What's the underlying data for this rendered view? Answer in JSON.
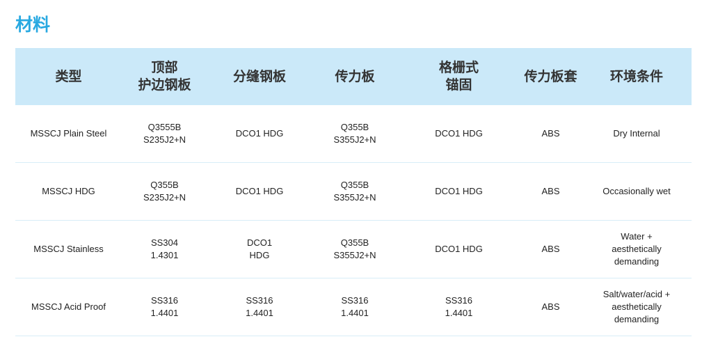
{
  "page": {
    "title": "材料"
  },
  "table": {
    "headers": [
      "类型",
      "顶部\n护边钢板",
      "分缝钢板",
      "传力板",
      "格栅式\n锚固",
      "传力板套",
      "环境条件"
    ],
    "rows": [
      [
        "MSSCJ Plain Steel",
        "Q3555B\nS235J2+N",
        "DCO1 HDG",
        "Q355B\nS355J2+N",
        "DCO1 HDG",
        "ABS",
        "Dry Internal"
      ],
      [
        "MSSCJ HDG",
        "Q355B\nS235J2+N",
        "DCO1 HDG",
        "Q355B\nS355J2+N",
        "DCO1 HDG",
        "ABS",
        "Occasionally wet"
      ],
      [
        "MSSCJ Stainless",
        "SS304\n1.4301",
        "DCO1\nHDG",
        "Q355B\nS355J2+N",
        "DCO1 HDG",
        "ABS",
        "Water +\naesthetically\ndemanding"
      ],
      [
        "MSSCJ Acid Proof",
        "SS316\n1.4401",
        "SS316\n1.4401",
        "SS316\n1.4401",
        "SS316\n1.4401",
        "ABS",
        "Salt/water/acid +\naesthetically\ndemanding"
      ]
    ]
  },
  "colors": {
    "title": "#29a9e1",
    "header_background": "#cbe9f9",
    "row_divider": "#d7edf7"
  }
}
